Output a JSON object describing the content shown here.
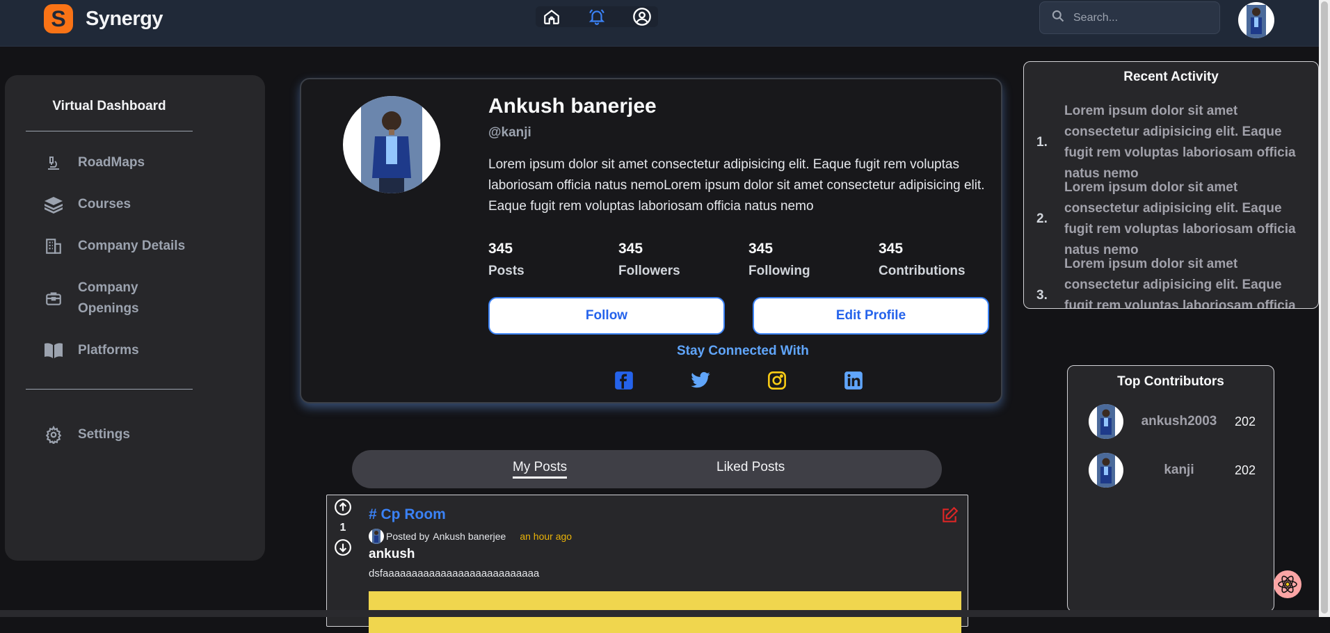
{
  "brand": {
    "logo_letter": "S",
    "name": "Synergy",
    "accent": "#f97316"
  },
  "nav": {
    "icons": [
      "home-icon",
      "bell-icon",
      "user-circle-icon"
    ],
    "active": "bell-icon"
  },
  "search": {
    "placeholder": "Search..."
  },
  "sidebar": {
    "title": "Virtual Dashboard",
    "items": [
      {
        "label": "RoadMaps",
        "icon": "microscope-icon"
      },
      {
        "label": "Courses",
        "icon": "layers-icon"
      },
      {
        "label": "Company Details",
        "icon": "building-icon"
      },
      {
        "label": "Company Openings",
        "icon": "briefcase-icon"
      },
      {
        "label": "Platforms",
        "icon": "book-icon"
      }
    ],
    "settings": {
      "label": "Settings",
      "icon": "gear-icon"
    }
  },
  "profile": {
    "name": "Ankush banerjee",
    "handle": "@kanji",
    "bio": "Lorem ipsum dolor sit amet consectetur adipisicing elit. Eaque fugit rem voluptas laboriosam officia natus nemoLorem ipsum dolor sit amet consectetur adipisicing elit. Eaque fugit rem voluptas laboriosam officia natus nemo",
    "stats": [
      {
        "value": "345",
        "label": "Posts"
      },
      {
        "value": "345",
        "label": "Followers"
      },
      {
        "value": "345",
        "label": "Following"
      },
      {
        "value": "345",
        "label": "Contributions"
      }
    ],
    "follow_label": "Follow",
    "edit_label": "Edit Profile",
    "stay_connected": "Stay Connected With",
    "socials": [
      "facebook-icon",
      "twitter-icon",
      "instagram-icon",
      "linkedin-icon"
    ]
  },
  "tabs": {
    "my_posts": "My Posts",
    "liked_posts": "Liked Posts",
    "active": "My Posts"
  },
  "post": {
    "votes": "1",
    "room": "# Cp Room",
    "posted_by": "Posted by",
    "author": "Ankush banerjee",
    "time": "an hour ago",
    "title": "ankush",
    "body": "dsfaaaaaaaaaaaaaaaaaaaaaaaaaaa"
  },
  "recent_activity": {
    "title": "Recent Activity",
    "items": [
      {
        "num": "1.",
        "text": "Lorem ipsum dolor sit amet consectetur adipisicing elit. Eaque fugit rem voluptas laboriosam officia natus nemo"
      },
      {
        "num": "2.",
        "text": "Lorem ipsum dolor sit amet consectetur adipisicing elit. Eaque fugit rem voluptas laboriosam officia natus nemo"
      },
      {
        "num": "3.",
        "text": "Lorem ipsum dolor sit amet consectetur adipisicing elit. Eaque fugit rem voluptas laboriosam officia natus nemo"
      }
    ]
  },
  "top_contributors": {
    "title": "Top Contributors",
    "rows": [
      {
        "name": "ankush2003",
        "score": "202"
      },
      {
        "name": "kanji",
        "score": "202"
      }
    ]
  }
}
